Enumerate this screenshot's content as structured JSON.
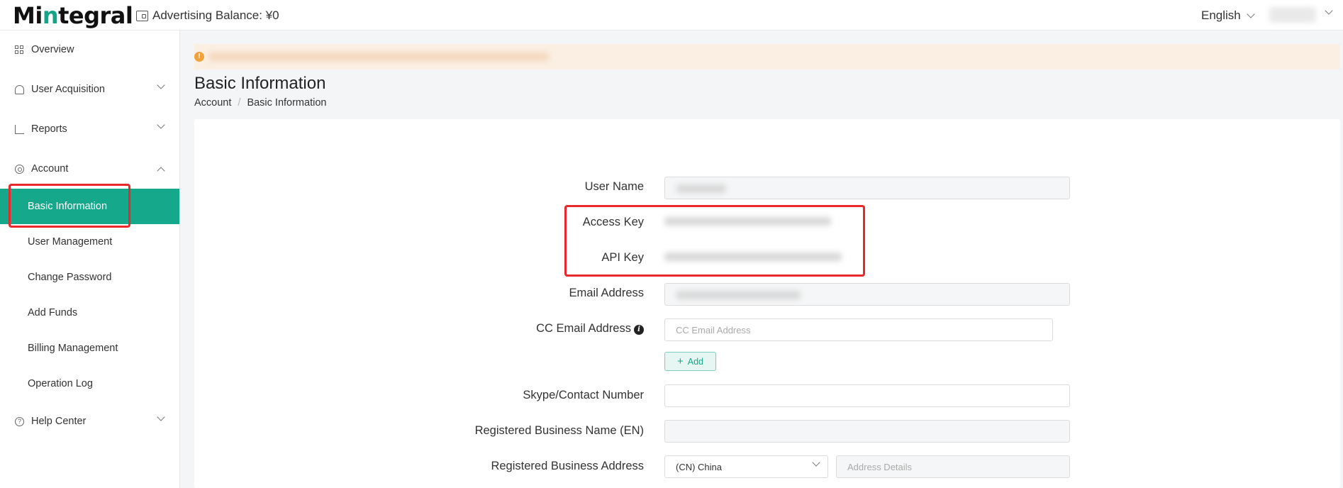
{
  "header": {
    "logo_prefix": "Mi",
    "logo_i": "n",
    "logo_rest": "tegral",
    "balance_label": "Advertising Balance: ¥0",
    "language": "English"
  },
  "sidebar": {
    "overview": "Overview",
    "user_acquisition": "User Acquisition",
    "reports": "Reports",
    "account": "Account",
    "account_items": [
      "Basic Information",
      "User Management",
      "Change Password",
      "Add Funds",
      "Billing Management",
      "Operation Log"
    ],
    "help_center": "Help Center"
  },
  "page": {
    "title": "Basic Information",
    "breadcrumb": [
      "Account",
      "Basic Information"
    ]
  },
  "form": {
    "user_name_label": "User Name",
    "access_key_label": "Access Key",
    "api_key_label": "API Key",
    "email_label": "Email Address",
    "cc_email_label": "CC Email Address",
    "cc_email_placeholder": "CC Email Address",
    "add_button": "Add",
    "skype_label": "Skype/Contact Number",
    "business_name_label": "Registered Business Name (EN)",
    "business_address_label": "Registered Business Address",
    "country_value": "(CN) China",
    "address_details_placeholder": "Address Details"
  },
  "colors": {
    "accent": "#15a88a",
    "highlight": "#e8282a",
    "warning": "#f2a23a"
  }
}
